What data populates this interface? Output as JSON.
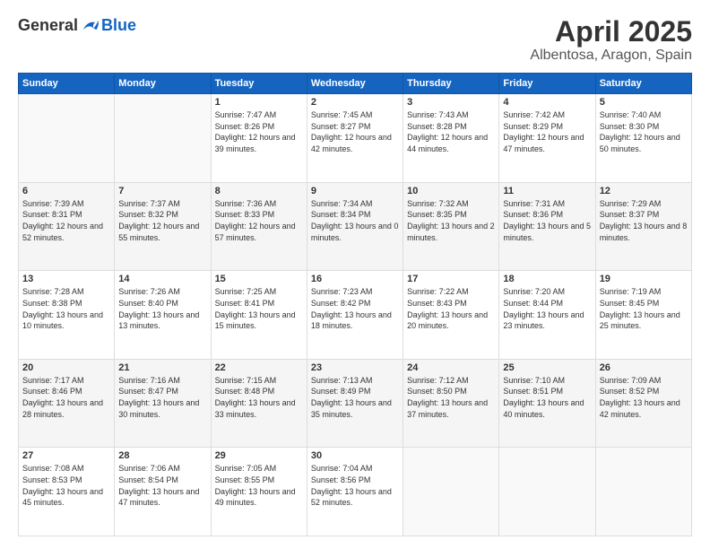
{
  "header": {
    "logo_general": "General",
    "logo_blue": "Blue",
    "main_title": "April 2025",
    "subtitle": "Albentosa, Aragon, Spain"
  },
  "weekdays": [
    "Sunday",
    "Monday",
    "Tuesday",
    "Wednesday",
    "Thursday",
    "Friday",
    "Saturday"
  ],
  "weeks": [
    [
      {
        "num": "",
        "info": ""
      },
      {
        "num": "",
        "info": ""
      },
      {
        "num": "1",
        "info": "Sunrise: 7:47 AM\nSunset: 8:26 PM\nDaylight: 12 hours and 39 minutes."
      },
      {
        "num": "2",
        "info": "Sunrise: 7:45 AM\nSunset: 8:27 PM\nDaylight: 12 hours and 42 minutes."
      },
      {
        "num": "3",
        "info": "Sunrise: 7:43 AM\nSunset: 8:28 PM\nDaylight: 12 hours and 44 minutes."
      },
      {
        "num": "4",
        "info": "Sunrise: 7:42 AM\nSunset: 8:29 PM\nDaylight: 12 hours and 47 minutes."
      },
      {
        "num": "5",
        "info": "Sunrise: 7:40 AM\nSunset: 8:30 PM\nDaylight: 12 hours and 50 minutes."
      }
    ],
    [
      {
        "num": "6",
        "info": "Sunrise: 7:39 AM\nSunset: 8:31 PM\nDaylight: 12 hours and 52 minutes."
      },
      {
        "num": "7",
        "info": "Sunrise: 7:37 AM\nSunset: 8:32 PM\nDaylight: 12 hours and 55 minutes."
      },
      {
        "num": "8",
        "info": "Sunrise: 7:36 AM\nSunset: 8:33 PM\nDaylight: 12 hours and 57 minutes."
      },
      {
        "num": "9",
        "info": "Sunrise: 7:34 AM\nSunset: 8:34 PM\nDaylight: 13 hours and 0 minutes."
      },
      {
        "num": "10",
        "info": "Sunrise: 7:32 AM\nSunset: 8:35 PM\nDaylight: 13 hours and 2 minutes."
      },
      {
        "num": "11",
        "info": "Sunrise: 7:31 AM\nSunset: 8:36 PM\nDaylight: 13 hours and 5 minutes."
      },
      {
        "num": "12",
        "info": "Sunrise: 7:29 AM\nSunset: 8:37 PM\nDaylight: 13 hours and 8 minutes."
      }
    ],
    [
      {
        "num": "13",
        "info": "Sunrise: 7:28 AM\nSunset: 8:38 PM\nDaylight: 13 hours and 10 minutes."
      },
      {
        "num": "14",
        "info": "Sunrise: 7:26 AM\nSunset: 8:40 PM\nDaylight: 13 hours and 13 minutes."
      },
      {
        "num": "15",
        "info": "Sunrise: 7:25 AM\nSunset: 8:41 PM\nDaylight: 13 hours and 15 minutes."
      },
      {
        "num": "16",
        "info": "Sunrise: 7:23 AM\nSunset: 8:42 PM\nDaylight: 13 hours and 18 minutes."
      },
      {
        "num": "17",
        "info": "Sunrise: 7:22 AM\nSunset: 8:43 PM\nDaylight: 13 hours and 20 minutes."
      },
      {
        "num": "18",
        "info": "Sunrise: 7:20 AM\nSunset: 8:44 PM\nDaylight: 13 hours and 23 minutes."
      },
      {
        "num": "19",
        "info": "Sunrise: 7:19 AM\nSunset: 8:45 PM\nDaylight: 13 hours and 25 minutes."
      }
    ],
    [
      {
        "num": "20",
        "info": "Sunrise: 7:17 AM\nSunset: 8:46 PM\nDaylight: 13 hours and 28 minutes."
      },
      {
        "num": "21",
        "info": "Sunrise: 7:16 AM\nSunset: 8:47 PM\nDaylight: 13 hours and 30 minutes."
      },
      {
        "num": "22",
        "info": "Sunrise: 7:15 AM\nSunset: 8:48 PM\nDaylight: 13 hours and 33 minutes."
      },
      {
        "num": "23",
        "info": "Sunrise: 7:13 AM\nSunset: 8:49 PM\nDaylight: 13 hours and 35 minutes."
      },
      {
        "num": "24",
        "info": "Sunrise: 7:12 AM\nSunset: 8:50 PM\nDaylight: 13 hours and 37 minutes."
      },
      {
        "num": "25",
        "info": "Sunrise: 7:10 AM\nSunset: 8:51 PM\nDaylight: 13 hours and 40 minutes."
      },
      {
        "num": "26",
        "info": "Sunrise: 7:09 AM\nSunset: 8:52 PM\nDaylight: 13 hours and 42 minutes."
      }
    ],
    [
      {
        "num": "27",
        "info": "Sunrise: 7:08 AM\nSunset: 8:53 PM\nDaylight: 13 hours and 45 minutes."
      },
      {
        "num": "28",
        "info": "Sunrise: 7:06 AM\nSunset: 8:54 PM\nDaylight: 13 hours and 47 minutes."
      },
      {
        "num": "29",
        "info": "Sunrise: 7:05 AM\nSunset: 8:55 PM\nDaylight: 13 hours and 49 minutes."
      },
      {
        "num": "30",
        "info": "Sunrise: 7:04 AM\nSunset: 8:56 PM\nDaylight: 13 hours and 52 minutes."
      },
      {
        "num": "",
        "info": ""
      },
      {
        "num": "",
        "info": ""
      },
      {
        "num": "",
        "info": ""
      }
    ]
  ]
}
